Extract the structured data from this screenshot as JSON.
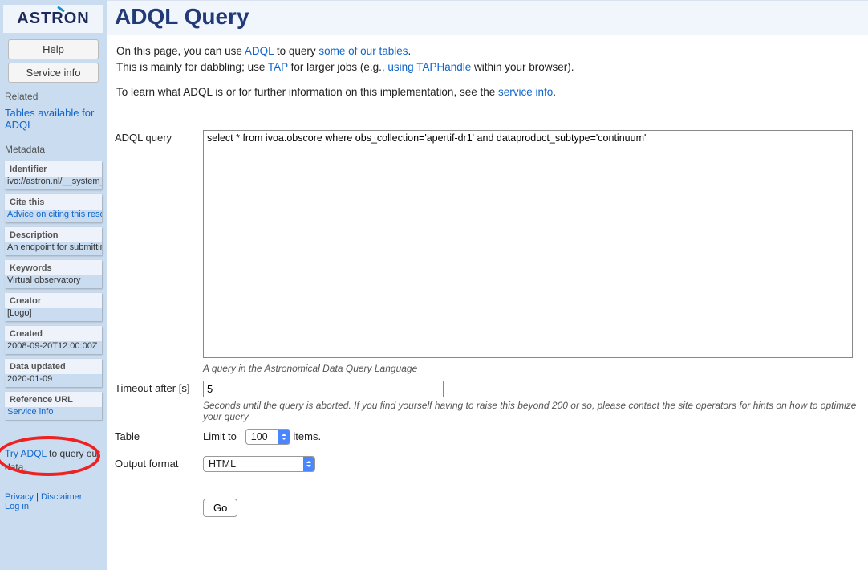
{
  "logo": {
    "text": "ASTRON"
  },
  "sidebar": {
    "buttons": {
      "help": "Help",
      "service_info": "Service info"
    },
    "related": {
      "heading": "Related",
      "tables_link": "Tables available for ADQL"
    },
    "metadata": {
      "heading": "Metadata",
      "identifier": {
        "title": "Identifier",
        "value": "ivo://astron.nl/__system__/a"
      },
      "cite": {
        "title": "Cite this",
        "link": "Advice on citing this resour"
      },
      "description": {
        "title": "Description",
        "value": "An endpoint for submitting"
      },
      "keywords": {
        "title": "Keywords",
        "value": "Virtual observatory"
      },
      "creator": {
        "title": "Creator",
        "value": "[Logo]"
      },
      "created": {
        "title": "Created",
        "value": "2008-09-20T12:00:00Z"
      },
      "updated": {
        "title": "Data updated",
        "value": "2020-01-09"
      },
      "ref_url": {
        "title": "Reference URL",
        "link": "Service info"
      }
    },
    "try_adql": {
      "link": "Try ADQL",
      "rest": " to query our data."
    },
    "footer": {
      "privacy": "Privacy",
      "sep": " | ",
      "disclaimer": "Disclaimer",
      "login": "Log in"
    }
  },
  "main": {
    "title": "ADQL Query",
    "intro": {
      "p1a": "On this page, you can use ",
      "adql_link": "ADQL",
      "p1b": " to query ",
      "tables_link": "some of our tables",
      "p1c": ".",
      "p2a": "This is mainly for dabbling; use ",
      "tap_link": "TAP",
      "p2b": " for larger jobs (e.g., ",
      "using_link": "using TAPHandle",
      "p2c": " within your browser).",
      "p3a": "To learn what ADQL is or for further information on this implementation, see the ",
      "service_info_link": "service info",
      "p3b": "."
    },
    "form": {
      "query": {
        "label": "ADQL query",
        "value": "select * from ivoa.obscore where obs_collection='apertif-dr1' and dataproduct_subtype='continuum'",
        "help": "A query in the Astronomical Data Query Language"
      },
      "timeout": {
        "label": "Timeout after [s]",
        "value": "5",
        "help": "Seconds until the query is aborted. If you find yourself having to raise this beyond 200 or so, please contact the site operators for hints on how to optimize your query"
      },
      "table": {
        "label": "Table",
        "limit_prefix": "Limit to",
        "limit_value": "100",
        "limit_suffix": " items."
      },
      "output": {
        "label": "Output format",
        "value": "HTML"
      },
      "submit": "Go"
    }
  }
}
